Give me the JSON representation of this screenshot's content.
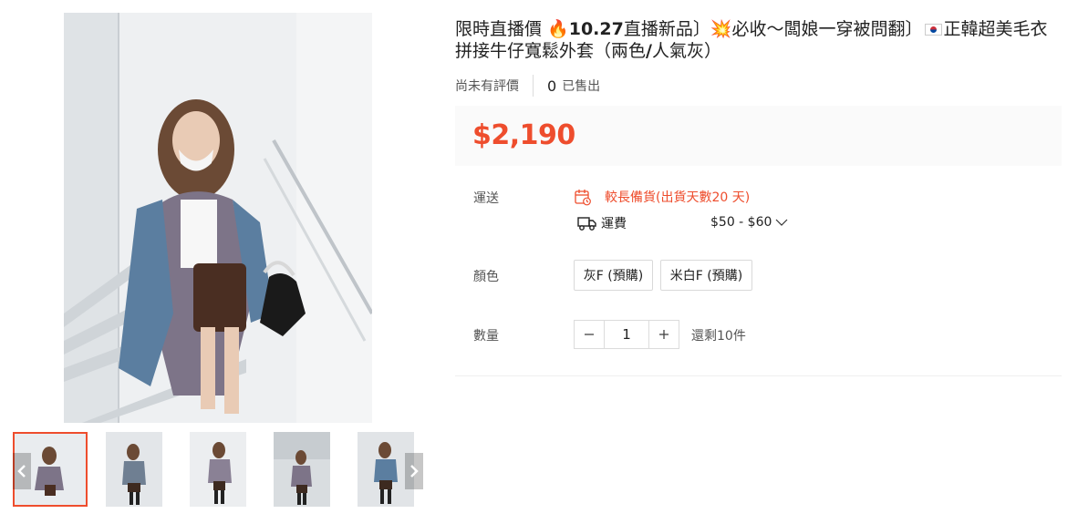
{
  "product": {
    "title_prefix": "限時直播價 ",
    "fire_icon": "🔥",
    "title_bold": "10.27",
    "title_mid": "直播新品〕",
    "burst_icon": "💥",
    "title_mid2": "必收～闆娘一穿被問翻〕",
    "title_suffix": "正韓超美毛衣拼接牛仔寬鬆外套（兩色",
    "title_bold2": "/",
    "title_end": "人氣灰）"
  },
  "rating": {
    "no_reviews": "尚未有評價",
    "sold_count": "0",
    "sold_label": "已售出"
  },
  "price": "$2,190",
  "shipping": {
    "label": "運送",
    "preorder_note": "較長備貨(出貨天數20 天)",
    "fee_label": "運費",
    "fee_range": "$50 - $60"
  },
  "variants": {
    "label": "顏色",
    "options": [
      "灰F (預購)",
      "米白F (預購)"
    ]
  },
  "quantity": {
    "label": "數量",
    "value": "1",
    "stock": "還剩10件"
  },
  "colors": {
    "accent": "#ee4d2d",
    "price_bg": "#fafafa"
  }
}
